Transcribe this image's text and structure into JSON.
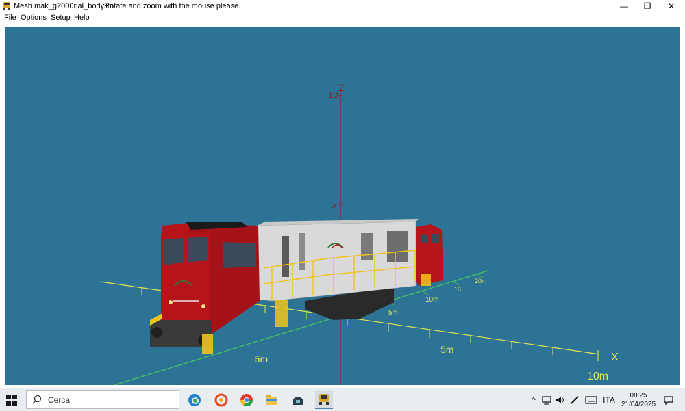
{
  "window": {
    "title": "Mesh mak_g2000rial_body.im",
    "hint": "Rotate and zoom with the mouse please.",
    "minimize_glyph": "—",
    "restore_glyph": "❐",
    "close_glyph": "✕"
  },
  "menu": {
    "file": "File",
    "options": "Options",
    "setup": "Setup",
    "help": "Help"
  },
  "viewport": {
    "background": "#2c7396",
    "axes": {
      "z_label": "Z",
      "z_ticks": [
        "10",
        "5"
      ],
      "x_label": "X",
      "x_ticks": [
        "10m",
        "5m",
        "-5m"
      ],
      "y_ticks": [
        "20m",
        "15",
        "10m",
        "5m"
      ]
    },
    "colors": {
      "x_axis": "#e8e84a",
      "y_axis": "#46c95a",
      "z_axis": "#8b2323",
      "body_red": "#b5141b",
      "body_gray": "#d9d9d9"
    }
  },
  "taskbar": {
    "search_placeholder": "Cerca",
    "icons": [
      "windows-start-icon",
      "edge-icon",
      "app-icon",
      "chrome-icon",
      "file-explorer-icon",
      "app2-icon",
      "mesh-viewer-icon"
    ],
    "language": "ITA",
    "time": "08:25",
    "date": "21/04/2025"
  }
}
